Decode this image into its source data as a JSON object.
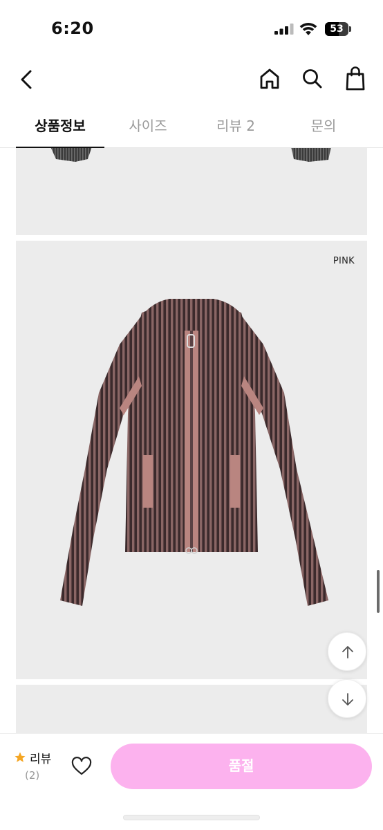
{
  "status_bar": {
    "time": "6:20",
    "battery_level": "53"
  },
  "nav": {
    "back_icon": "chevron-left-icon",
    "home_icon": "home-icon",
    "search_icon": "search-icon",
    "cart_icon": "shopping-bag-icon"
  },
  "tabs": [
    {
      "label": "상품정보",
      "active": true
    },
    {
      "label": "사이즈",
      "active": false
    },
    {
      "label": "리뷰 2",
      "active": false
    },
    {
      "label": "문의",
      "active": false
    }
  ],
  "product": {
    "color_label": "PINK",
    "colors": {
      "knit_dark": "#3b2a2c",
      "knit_rib": "#8a6665",
      "trim": "#b98580",
      "panel_bg": "#ececec"
    }
  },
  "bottom_bar": {
    "review_label": "리뷰",
    "review_count": "(2)",
    "soldout_label": "품절",
    "accent_color": "#fcb2ee",
    "star_color": "#f5a623"
  }
}
